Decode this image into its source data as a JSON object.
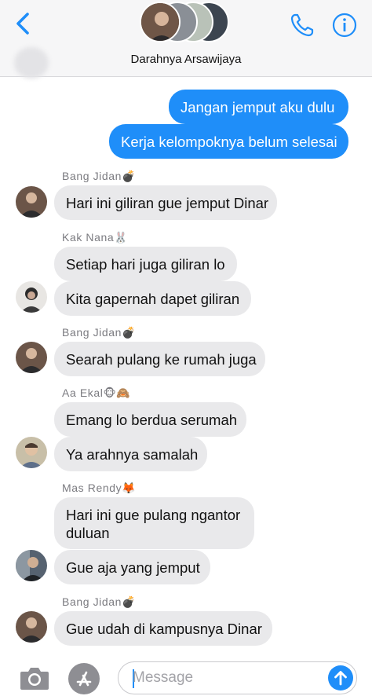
{
  "header": {
    "title": "Darahnya Arsawijaya",
    "back_icon": "chevron-left-icon",
    "call_icon": "phone-icon",
    "info_icon": "info-icon"
  },
  "messages": {
    "out1": "Jangan jemput aku dulu",
    "out2": "Kerja kelompoknya belum selesai",
    "sender1": "Bang Jidan💣",
    "m1": "Hari ini giliran gue jemput Dinar",
    "sender2": "Kak Nana🐰",
    "m2": "Setiap hari juga giliran lo",
    "m3": "Kita gapernah dapet giliran",
    "sender3": "Bang Jidan💣",
    "m4": "Searah pulang ke rumah juga",
    "sender4": "Aa Ekal🐵🙈",
    "m5": "Emang lo berdua serumah",
    "m6": "Ya arahnya samalah",
    "sender5": "Mas Rendy🦊",
    "m7_line1": "Hari ini gue pulang ngantor",
    "m7_line2": "duluan",
    "m8": "Gue aja yang jemput",
    "sender6": "Bang Jidan💣",
    "m9": "Gue udah di kampusnya Dinar"
  },
  "composer": {
    "placeholder": "Message",
    "camera_icon": "camera-icon",
    "apps_icon": "app-store-icon",
    "send_icon": "send-arrow-icon"
  },
  "colors": {
    "outgoing": "#1f8ef9",
    "incoming": "#e9e9eb",
    "accent": "#1f8ef9"
  }
}
